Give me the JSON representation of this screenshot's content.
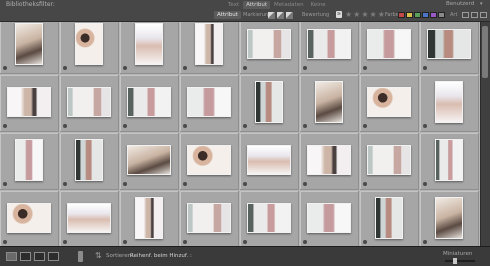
{
  "filter_bar": {
    "title": "Bibliotheksfilter:",
    "tabs": [
      {
        "label": "Text",
        "active": false
      },
      {
        "label": "Attribut",
        "active": true
      },
      {
        "label": "Metadaten",
        "active": false
      },
      {
        "label": "Keine",
        "active": false
      }
    ],
    "preset": "Benutzerd",
    "attribute_label": "Attribut",
    "flag_label": "Markierung",
    "rating_label": "Bewertung",
    "rating_operator": "≥",
    "stars": [
      "★",
      "★",
      "★",
      "★",
      "★"
    ],
    "color_label": "Farbe",
    "color_swatches": [
      "#c44a4a",
      "#d8c04a",
      "#5aa05a",
      "#4a74c8",
      "#9a5ac4",
      "#8a8a8a"
    ],
    "kind_label": "Art"
  },
  "grid": {
    "background": "#b6b6b6",
    "rows": [
      [
        "portrait",
        "portrait",
        "portrait",
        "portrait",
        "landscape",
        "landscape",
        "landscape",
        "landscape"
      ],
      [
        "landscape",
        "landscape",
        "landscape",
        "landscape",
        "portrait",
        "portrait",
        "landscape",
        "portrait"
      ],
      [
        "portrait",
        "portrait",
        "landscape",
        "landscape",
        "landscape",
        "landscape",
        "landscape",
        "portrait"
      ],
      [
        "landscape",
        "landscape",
        "portrait",
        "landscape",
        "landscape",
        "landscape",
        "portrait",
        "portrait"
      ]
    ]
  },
  "toolbar": {
    "sort_label": "Sortieren:",
    "sort_value": "Reihenf. beim Hinzuf. :",
    "thumbnails_label": "Miniaturen"
  }
}
